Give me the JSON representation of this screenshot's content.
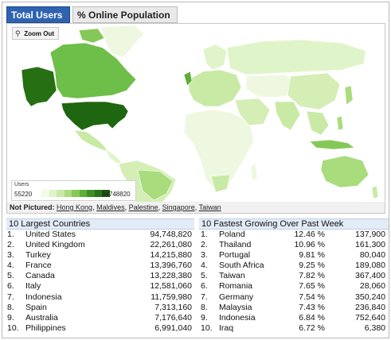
{
  "tabs": [
    {
      "label": "Total Users",
      "active": true
    },
    {
      "label": "% Online Population",
      "active": false
    }
  ],
  "map": {
    "zoom_label": "Zoom Out",
    "legend": {
      "title": "Users",
      "min": "55220",
      "max": "94748820",
      "scale_colors": [
        "#f2fae8",
        "#e0f4c9",
        "#c8eaa5",
        "#a9dc7d",
        "#86c858",
        "#5fae3a",
        "#3f8f25",
        "#2a7216",
        "#1b5a0c"
      ]
    },
    "not_pictured_label": "Not Pictured:",
    "not_pictured": [
      "Hong Kong",
      "Maldives",
      "Palestine",
      "Singapore",
      "Taiwan"
    ],
    "colors": {
      "land_light": "#eef8e0",
      "land_mid": "#d4eeb6",
      "usa": "#1f6611",
      "canada": "#6ebe4a",
      "alaska": "#266f13",
      "water": "#ffffff",
      "border": "#ffffff"
    }
  },
  "largest": {
    "title": "10 Largest Countries",
    "rows": [
      {
        "n": "1.",
        "name": "United States",
        "value": "94,748,820"
      },
      {
        "n": "2.",
        "name": "United Kingdom",
        "value": "22,261,080"
      },
      {
        "n": "3.",
        "name": "Turkey",
        "value": "14,215,880"
      },
      {
        "n": "4.",
        "name": "France",
        "value": "13,396,760"
      },
      {
        "n": "5.",
        "name": "Canada",
        "value": "13,228,380"
      },
      {
        "n": "6.",
        "name": "Italy",
        "value": "12,581,060"
      },
      {
        "n": "7.",
        "name": "Indonesia",
        "value": "11,759,980"
      },
      {
        "n": "8.",
        "name": "Spain",
        "value": "7,313,160"
      },
      {
        "n": "9.",
        "name": "Australia",
        "value": "7,176,640"
      },
      {
        "n": "10.",
        "name": "Philippines",
        "value": "6,991,040"
      }
    ]
  },
  "fastest": {
    "title": "10 Fastest Growing Over Past Week",
    "rows": [
      {
        "n": "1.",
        "name": "Poland",
        "pct": "12.46 %",
        "value": "137,900"
      },
      {
        "n": "2.",
        "name": "Thailand",
        "pct": "10.96 %",
        "value": "161,300"
      },
      {
        "n": "3.",
        "name": "Portugal",
        "pct": "9.81 %",
        "value": "80,040"
      },
      {
        "n": "4.",
        "name": "South Africa",
        "pct": "9.25 %",
        "value": "189,080"
      },
      {
        "n": "5.",
        "name": "Taiwan",
        "pct": "7.82 %",
        "value": "367,400"
      },
      {
        "n": "6.",
        "name": "Romania",
        "pct": "7.65 %",
        "value": "28,060"
      },
      {
        "n": "7.",
        "name": "Germany",
        "pct": "7.54 %",
        "value": "350,240"
      },
      {
        "n": "8.",
        "name": "Malaysia",
        "pct": "7.43 %",
        "value": "236,840"
      },
      {
        "n": "9.",
        "name": "Indonesia",
        "pct": "6.84 %",
        "value": "752,640"
      },
      {
        "n": "10.",
        "name": "Iraq",
        "pct": "6.72 %",
        "value": "6,380"
      }
    ]
  }
}
